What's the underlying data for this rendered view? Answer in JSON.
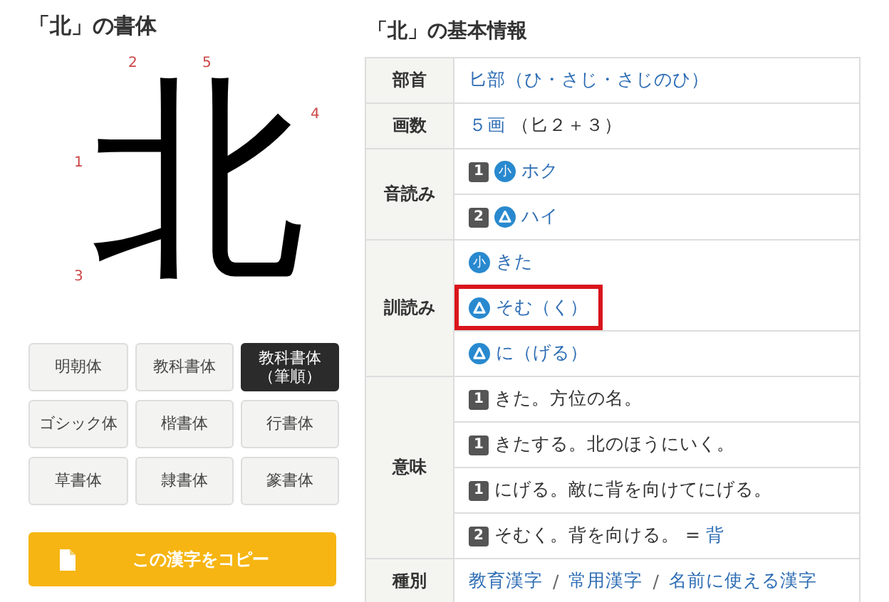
{
  "style_panel": {
    "title": "「北」の書体",
    "character": "北",
    "stroke_numbers": [
      "1",
      "2",
      "3",
      "4",
      "5"
    ],
    "styles": [
      {
        "label": "明朝体",
        "selected": false
      },
      {
        "label": "教科書体",
        "selected": false
      },
      {
        "label": "教科書体（筆順）",
        "selected": true
      },
      {
        "label": "ゴシック体",
        "selected": false
      },
      {
        "label": "楷書体",
        "selected": false
      },
      {
        "label": "行書体",
        "selected": false
      },
      {
        "label": "草書体",
        "selected": false
      },
      {
        "label": "隷書体",
        "selected": false
      },
      {
        "label": "篆書体",
        "selected": false
      }
    ],
    "copy_button": "この漢字をコピー"
  },
  "info": {
    "title": "「北」の基本情報",
    "rows": [
      {
        "header": "部首",
        "lines": [
          {
            "parts": [
              {
                "text": "匕部（ひ・さじ・さじのひ）",
                "link": true
              }
            ]
          }
        ]
      },
      {
        "header": "画数",
        "lines": [
          {
            "parts": [
              {
                "text": "５画",
                "link": true
              },
              {
                "text": "（匕２＋３）",
                "link": false
              }
            ]
          }
        ]
      },
      {
        "header": "音読み",
        "lines": [
          {
            "number": "1",
            "mark": {
              "kind": "elementary",
              "label": "小"
            },
            "parts": [
              {
                "text": "ホク",
                "link": true
              }
            ]
          },
          {
            "number": "2",
            "mark": {
              "kind": "outside"
            },
            "parts": [
              {
                "text": "ハイ",
                "link": true
              }
            ]
          }
        ]
      },
      {
        "header": "訓読み",
        "lines": [
          {
            "mark": {
              "kind": "elementary",
              "label": "小"
            },
            "parts": [
              {
                "text": "きた",
                "link": true
              }
            ],
            "highlighted": false
          },
          {
            "mark": {
              "kind": "outside"
            },
            "parts": [
              {
                "text": "そむ（く）",
                "link": true
              }
            ],
            "highlighted": true
          },
          {
            "mark": {
              "kind": "outside"
            },
            "parts": [
              {
                "text": "に（げる）",
                "link": true
              }
            ],
            "highlighted": false
          }
        ]
      },
      {
        "header": "意味",
        "lines": [
          {
            "number": "1",
            "parts": [
              {
                "text": "きた。方位の名。",
                "link": false
              }
            ]
          },
          {
            "number": "1",
            "parts": [
              {
                "text": "きたする。北のほうにいく。",
                "link": false
              }
            ]
          },
          {
            "number": "1",
            "parts": [
              {
                "text": "にげる。敵に背を向けてにげる。",
                "link": false
              }
            ]
          },
          {
            "number": "2",
            "parts": [
              {
                "text": "そむく。背を向ける。 =",
                "link": false
              },
              {
                "text": "背",
                "link": true
              }
            ]
          }
        ]
      },
      {
        "header": "種別",
        "lines": [
          {
            "parts": [
              {
                "text": "教育漢字",
                "link": true
              },
              {
                "text": "/",
                "link": false
              },
              {
                "text": "常用漢字",
                "link": true
              },
              {
                "text": "/",
                "link": false
              },
              {
                "text": "名前に使える漢字",
                "link": true
              }
            ]
          }
        ]
      }
    ]
  }
}
